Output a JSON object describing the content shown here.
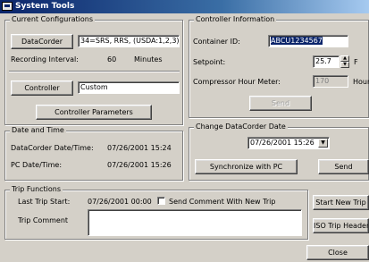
{
  "window": {
    "title": "System Tools"
  },
  "current_configurations": {
    "legend": "Current Configurations",
    "datacorder_button": "DataCorder",
    "datacorder_value": "34=SRS, RRS, (USDA:1,2,3), H",
    "recording_interval_label": "Recording Interval:",
    "recording_interval_value": "60",
    "recording_interval_unit": "Minutes",
    "controller_button": "Controller",
    "controller_value": "Custom",
    "controller_parameters_button": "Controller Parameters"
  },
  "date_and_time": {
    "legend": "Date and Time",
    "datacorder_label": "DataCorder Date/Time:",
    "datacorder_value": "07/26/2001 15:24",
    "pc_label": "PC Date/Time:",
    "pc_value": "07/26/2001 15:26"
  },
  "controller_information": {
    "legend": "Controller Information",
    "container_id_label": "Container ID:",
    "container_id_value": "ABCU1234567",
    "setpoint_label": "Setpoint:",
    "setpoint_value": "25.7",
    "setpoint_unit": "F",
    "compressor_label": "Compressor Hour Meter:",
    "compressor_value": "170",
    "compressor_unit": "Hours",
    "send_button": "Send"
  },
  "change_datacorder_date": {
    "legend": "Change DataCorder Date",
    "date_value": "07/26/2001 15:26",
    "synchronize_button": "Synchronize with PC",
    "send_button": "Send"
  },
  "trip_functions": {
    "legend": "Trip Functions",
    "last_trip_start_label": "Last Trip Start:",
    "last_trip_start_value": "07/26/2001 00:00",
    "send_comment_label": "Send Comment With New Trip",
    "trip_comment_label": "Trip Comment",
    "trip_comment_value": "",
    "start_new_trip_button": "Start New Trip",
    "iso_trip_header_button": "ISO Trip Header"
  },
  "close_button": "Close"
}
